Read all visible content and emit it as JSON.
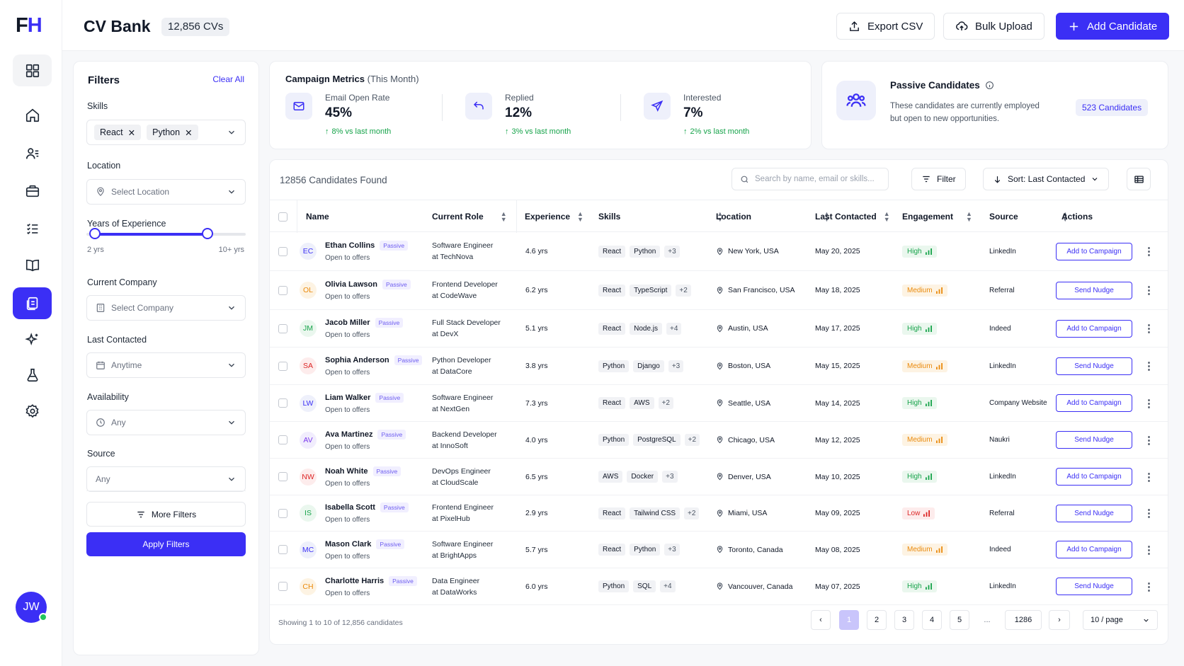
{
  "logo": {
    "text_a": "F",
    "text_b": "H"
  },
  "user": {
    "initials": "JW"
  },
  "header": {
    "title": "CV Bank",
    "count": "12,856 CVs",
    "export_label": "Export CSV",
    "bulk_label": "Bulk Upload",
    "add_label": "Add Candidate"
  },
  "filters": {
    "title": "Filters",
    "clear_all": "Clear All",
    "skills_label": "Skills",
    "skills": [
      "React",
      "Python"
    ],
    "location_label": "Location",
    "location_placeholder": "Select Location",
    "experience_label": "Years of Experience",
    "experience_min": "2 yrs",
    "experience_max": "10+ yrs",
    "experience_range_fraction": [
      0.0,
      0.89
    ],
    "company_label": "Current Company",
    "company_placeholder": "Select Company",
    "contacted_label": "Last Contacted",
    "contacted_value": "Anytime",
    "availability_label": "Availability",
    "availability_value": "Any",
    "source_label": "Source",
    "source_value": "Any",
    "more_filters": "More Filters",
    "apply": "Apply Filters"
  },
  "metrics": {
    "title": "Campaign Metrics",
    "period": "(This Month)",
    "items": [
      {
        "label": "Email Open Rate",
        "value": "45%",
        "delta": "8% vs last month"
      },
      {
        "label": "Replied",
        "value": "12%",
        "delta": "3% vs last month"
      },
      {
        "label": "Interested",
        "value": "7%",
        "delta": "2% vs last month"
      }
    ]
  },
  "passive": {
    "title": "Passive Candidates",
    "desc_line1": "These candidates are currently employed",
    "desc_line2": "but open to new opportunities.",
    "badge": "523 Candidates"
  },
  "table": {
    "found": "12856 Candidates Found",
    "search_placeholder": "Search by name, email or skills...",
    "filter_label": "Filter",
    "sort_label": "Sort: Last Contacted",
    "columns": [
      "Name",
      "Current Role",
      "Experience",
      "Skills",
      "Location",
      "Last Contacted",
      "Engagement",
      "Source",
      "Actions"
    ],
    "rows": [
      {
        "initials": "EC",
        "name": "Ethan Collins",
        "tag": "Passive",
        "status": "Open to offers",
        "role1": "Software Engineer",
        "role2": "at TechNova",
        "exp": "4.6 yrs",
        "skill1": "React",
        "skill2": "Python",
        "more": "+3",
        "location": "New York, USA",
        "date": "May 20, 2025",
        "engagement": "High",
        "source": "LinkedIn",
        "action": "Add to Campaign"
      },
      {
        "initials": "OL",
        "name": "Olivia Lawson",
        "tag": "Passive",
        "status": "Open to offers",
        "role1": "Frontend Developer",
        "role2": "at CodeWave",
        "exp": "6.2 yrs",
        "skill1": "React",
        "skill2": "TypeScript",
        "more": "+2",
        "location": "San Francisco, USA",
        "date": "May 18, 2025",
        "engagement": "Medium",
        "source": "Referral",
        "action": "Send Nudge"
      },
      {
        "initials": "JM",
        "name": "Jacob Miller",
        "tag": "Passive",
        "status": "Open to offers",
        "role1": "Full Stack Developer",
        "role2": "at DevX",
        "exp": "5.1 yrs",
        "skill1": "React",
        "skill2": "Node.js",
        "more": "+4",
        "location": "Austin, USA",
        "date": "May 17, 2025",
        "engagement": "High",
        "source": "Indeed",
        "action": "Add to Campaign"
      },
      {
        "initials": "SA",
        "name": "Sophia Anderson",
        "tag": "Passive",
        "status": "Open to offers",
        "role1": "Python Developer",
        "role2": "at DataCore",
        "exp": "3.8 yrs",
        "skill1": "Python",
        "skill2": "Django",
        "more": "+3",
        "location": "Boston, USA",
        "date": "May 15, 2025",
        "engagement": "Medium",
        "source": "LinkedIn",
        "action": "Send Nudge"
      },
      {
        "initials": "LW",
        "name": "Liam Walker",
        "tag": "Passive",
        "status": "Open to offers",
        "role1": "Software Engineer",
        "role2": "at NextGen",
        "exp": "7.3 yrs",
        "skill1": "React",
        "skill2": "AWS",
        "more": "+2",
        "location": "Seattle, USA",
        "date": "May 14, 2025",
        "engagement": "High",
        "source": "Company Website",
        "action": "Add to Campaign"
      },
      {
        "initials": "AV",
        "name": "Ava Martinez",
        "tag": "Passive",
        "status": "Open to offers",
        "role1": "Backend Developer",
        "role2": "at InnoSoft",
        "exp": "4.0 yrs",
        "skill1": "Python",
        "skill2": "PostgreSQL",
        "more": "+2",
        "location": "Chicago, USA",
        "date": "May 12, 2025",
        "engagement": "Medium",
        "source": "Naukri",
        "action": "Send Nudge"
      },
      {
        "initials": "NW",
        "name": "Noah White",
        "tag": "Passive",
        "status": "Open to offers",
        "role1": "DevOps Engineer",
        "role2": "at CloudScale",
        "exp": "6.5 yrs",
        "skill1": "AWS",
        "skill2": "Docker",
        "more": "+3",
        "location": "Denver, USA",
        "date": "May 10, 2025",
        "engagement": "High",
        "source": "LinkedIn",
        "action": "Add to Campaign"
      },
      {
        "initials": "IS",
        "name": "Isabella Scott",
        "tag": "Passive",
        "status": "Open to offers",
        "role1": "Frontend Engineer",
        "role2": "at PixelHub",
        "exp": "2.9 yrs",
        "skill1": "React",
        "skill2": "Tailwind CSS",
        "more": "+2",
        "location": "Miami, USA",
        "date": "May 09, 2025",
        "engagement": "Low",
        "source": "Referral",
        "action": "Send Nudge"
      },
      {
        "initials": "MC",
        "name": "Mason Clark",
        "tag": "Passive",
        "status": "Open to offers",
        "role1": "Software Engineer",
        "role2": "at BrightApps",
        "exp": "5.7 yrs",
        "skill1": "React",
        "skill2": "Python",
        "more": "+3",
        "location": "Toronto, Canada",
        "date": "May 08, 2025",
        "engagement": "Medium",
        "source": "Indeed",
        "action": "Add to Campaign"
      },
      {
        "initials": "CH",
        "name": "Charlotte Harris",
        "tag": "Passive",
        "status": "Open to offers",
        "role1": "Data Engineer",
        "role2": "at DataWorks",
        "exp": "6.0 yrs",
        "skill1": "Python",
        "skill2": "SQL",
        "more": "+4",
        "location": "Vancouver, Canada",
        "date": "May 07, 2025",
        "engagement": "High",
        "source": "LinkedIn",
        "action": "Send Nudge"
      }
    ],
    "footer": "Showing 1 to 10 of 12,856 candidates",
    "pages": [
      "1",
      "2",
      "3",
      "4",
      "5",
      "...",
      "1286"
    ],
    "per_page": "10 / page"
  },
  "colors": {
    "accent": "#3b2ff5",
    "high": "#16a34a",
    "medium": "#ea8a0c",
    "low": "#dc2626"
  }
}
